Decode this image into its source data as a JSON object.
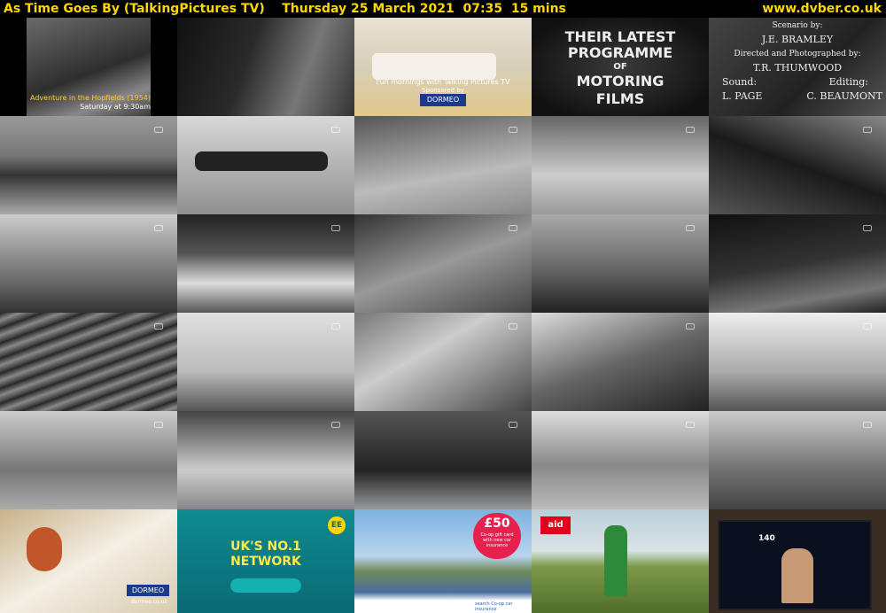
{
  "header": {
    "title": "As Time Goes By (TalkingPictures TV)",
    "date": "Thursday 25 March 2021",
    "time": "07:35",
    "duration": "15 mins",
    "site": "www.dvber.co.uk"
  },
  "tiles": [
    {
      "id": "r1c1",
      "lines": [
        "Adventure in the Hopfields (1954)",
        "Saturday at 9:30am"
      ]
    },
    {
      "id": "r1c2",
      "lines": []
    },
    {
      "id": "r1c3",
      "lines": [
        "Fun mornings with Talking Pictures TV",
        "Sponsored by",
        "DORMEO"
      ]
    },
    {
      "id": "r1c4",
      "lines": [
        "THEIR LATEST",
        "PROGRAMME",
        "OF",
        "MOTORING",
        "FILMS"
      ]
    },
    {
      "id": "r1c5",
      "lines": [
        "Scenario by:",
        "J.E. BRAMLEY",
        "Directed and Photographed by:",
        "T.R. THUMWOOD",
        "Sound:",
        "L. PAGE",
        "Editing:",
        "C. BEAUMONT"
      ]
    },
    {
      "id": "r6c1",
      "lines": [
        "DORMEO",
        "dormeo.co.uk"
      ]
    },
    {
      "id": "r6c2",
      "lines": [
        "UK'S NO.1",
        "NETWORK",
        "EE"
      ]
    },
    {
      "id": "r6c3",
      "lines": [
        "£50",
        "Co-op gift card",
        "with new car",
        "insurance",
        "search Co-op car insurance"
      ]
    },
    {
      "id": "r6c4",
      "lines": [
        "aid"
      ]
    },
    {
      "id": "r6c5",
      "lines": [
        "140"
      ]
    }
  ],
  "colors": {
    "header_text": "#ffd700",
    "background": "#000000"
  }
}
